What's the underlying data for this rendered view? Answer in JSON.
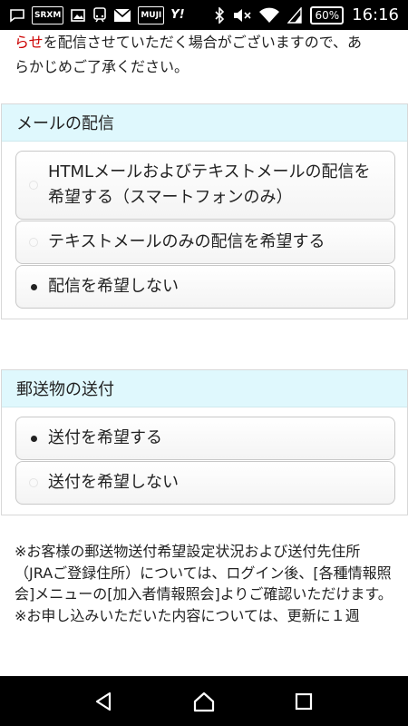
{
  "status_bar": {
    "left_icons": [
      "sirius-xm-icon",
      "image-icon",
      "train-icon",
      "mail-icon",
      "muji-icon",
      "yahoo-icon"
    ],
    "sirius_label": "SRXM",
    "muji_label": "MUJI",
    "yahoo_label": "Y!",
    "battery": "60%",
    "time": "16:16"
  },
  "intro": {
    "highlight": "らせ",
    "line1_rest": "を配信させていただく場合がございますので、あ",
    "line2": "らかじめご了承ください。"
  },
  "mail_section": {
    "title": "メールの配信",
    "options": [
      {
        "label": "HTMLメールおよびテキストメールの配信を希望する（スマートフォンのみ）",
        "selected": false
      },
      {
        "label": "テキストメールのみの配信を希望する",
        "selected": false
      },
      {
        "label": "配信を希望しない",
        "selected": true
      }
    ]
  },
  "post_section": {
    "title": "郵送物の送付",
    "options": [
      {
        "label": "送付を希望する",
        "selected": true
      },
      {
        "label": "送付を希望しない",
        "selected": false
      }
    ]
  },
  "notes": {
    "note1": "※お客様の郵送物送付希望設定状況および送付先住所（JRAご登録住所）については、ログイン後、[各種情報照会]メニューの[加入者情報照会]よりご確認いただけます。",
    "note2": "※お申し込みいただいた内容については、更新に１週"
  },
  "colors": {
    "section_header_bg": "#dff8fd",
    "highlight_text": "#cc0000"
  }
}
